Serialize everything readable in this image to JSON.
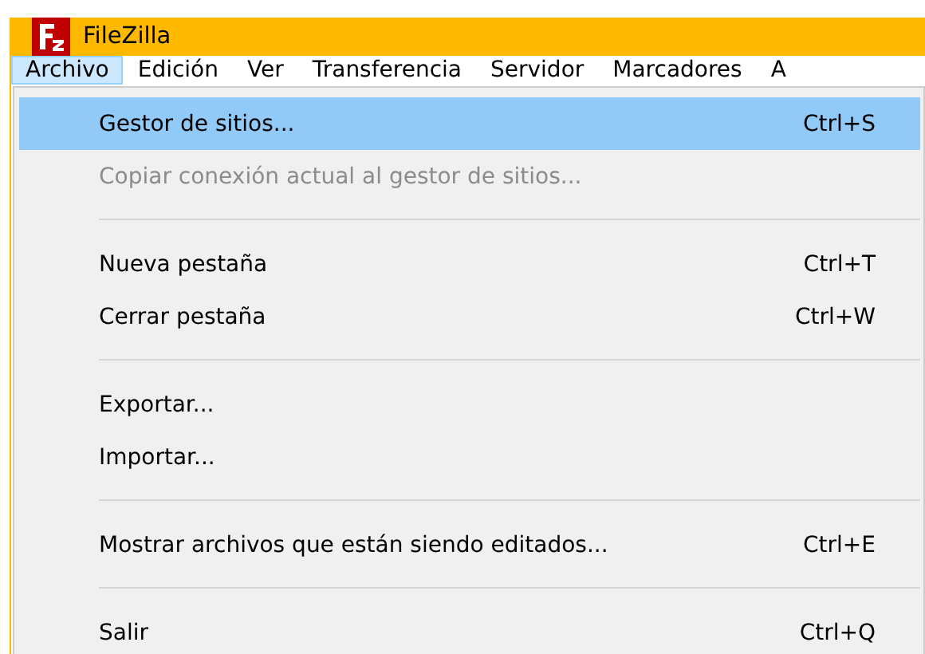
{
  "window": {
    "title": "FileZilla"
  },
  "menu_bar": [
    {
      "label": "Archivo",
      "selected": true
    },
    {
      "label": "Edición",
      "selected": false
    },
    {
      "label": "Ver",
      "selected": false
    },
    {
      "label": "Transferencia",
      "selected": false
    },
    {
      "label": "Servidor",
      "selected": false
    },
    {
      "label": "Marcadores",
      "selected": false
    },
    {
      "label": "A",
      "selected": false
    }
  ],
  "menu": [
    {
      "kind": "item",
      "label": "Gestor de sitios...",
      "shortcut": "Ctrl+S",
      "selected": true,
      "disabled": false
    },
    {
      "kind": "item",
      "label": "Copiar conexión actual al gestor de sitios...",
      "selected": false,
      "disabled": true
    },
    {
      "kind": "separator"
    },
    {
      "kind": "item",
      "label": "Nueva pestaña",
      "shortcut": "Ctrl+T",
      "selected": false,
      "disabled": false
    },
    {
      "kind": "item",
      "label": "Cerrar pestaña",
      "shortcut": "Ctrl+W",
      "selected": false,
      "disabled": false
    },
    {
      "kind": "separator"
    },
    {
      "kind": "item",
      "label": "Exportar...",
      "selected": false,
      "disabled": false
    },
    {
      "kind": "item",
      "label": "Importar...",
      "selected": false,
      "disabled": false
    },
    {
      "kind": "separator"
    },
    {
      "kind": "item",
      "label": "Mostrar archivos que están siendo editados...",
      "shortcut": "Ctrl+E",
      "selected": false,
      "disabled": false
    },
    {
      "kind": "separator"
    },
    {
      "kind": "item",
      "label": "Salir",
      "shortcut": "Ctrl+Q",
      "selected": false,
      "disabled": false
    }
  ]
}
